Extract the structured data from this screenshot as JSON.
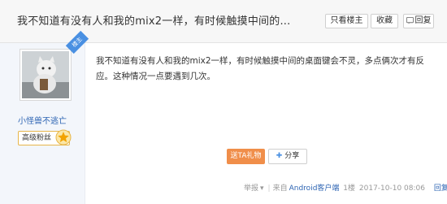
{
  "header": {
    "title": "我不知道有没有人和我的mix2一样，有时候触摸中间的...",
    "buttons": {
      "only_op": "只看楼主",
      "favorite": "收藏",
      "reply": "回复"
    }
  },
  "user": {
    "badge": "楼主",
    "name": "小怪兽不逃亡",
    "fan_level": "高级粉丝",
    "level_icon": "star-level-icon"
  },
  "post": {
    "content": "我不知道有没有人和我的mix2一样，有时候触摸中间的桌面键会不灵，多点俩次才有反应。这种情况一点要遇到几次。"
  },
  "actions": {
    "tip": "送TA礼物",
    "share": "分享"
  },
  "footer": {
    "report": "举报",
    "source_prefix": "来自",
    "client": "Android客户端",
    "floor": "1楼",
    "timestamp": "2017-10-10 08:06",
    "reply": "回复"
  },
  "colors": {
    "link": "#2d64b3",
    "tip_button": "#f08e4a",
    "badge": "#4a90e2",
    "level_border": "#e7b64a"
  }
}
